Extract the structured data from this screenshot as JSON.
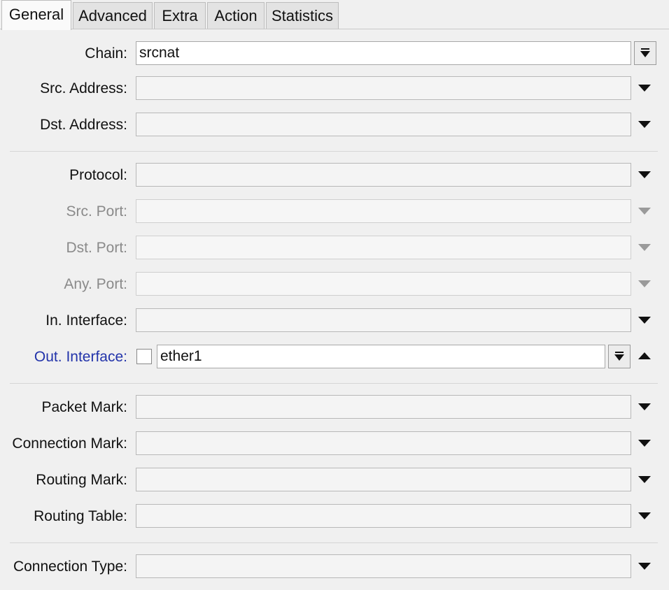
{
  "tabs": [
    {
      "label": "General",
      "active": true
    },
    {
      "label": "Advanced",
      "active": false
    },
    {
      "label": "Extra",
      "active": false
    },
    {
      "label": "Action",
      "active": false
    },
    {
      "label": "Statistics",
      "active": false
    }
  ],
  "fields": {
    "chain": {
      "label": "Chain:",
      "value": "srcnat"
    },
    "src_address": {
      "label": "Src. Address:",
      "value": ""
    },
    "dst_address": {
      "label": "Dst. Address:",
      "value": ""
    },
    "protocol": {
      "label": "Protocol:",
      "value": ""
    },
    "src_port": {
      "label": "Src. Port:",
      "value": "",
      "disabled": true
    },
    "dst_port": {
      "label": "Dst. Port:",
      "value": "",
      "disabled": true
    },
    "any_port": {
      "label": "Any. Port:",
      "value": "",
      "disabled": true
    },
    "in_interface": {
      "label": "In. Interface:",
      "value": ""
    },
    "out_interface": {
      "label": "Out. Interface:",
      "value": "ether1",
      "negate": false
    },
    "packet_mark": {
      "label": "Packet Mark:",
      "value": ""
    },
    "connection_mark": {
      "label": "Connection Mark:",
      "value": ""
    },
    "routing_mark": {
      "label": "Routing Mark:",
      "value": ""
    },
    "routing_table": {
      "label": "Routing Table:",
      "value": ""
    },
    "connection_type": {
      "label": "Connection Type:",
      "value": ""
    }
  },
  "colors": {
    "background": "#f0f0f0",
    "disabled_label": "#8a8a8a",
    "highlighted_label": "#2233aa"
  }
}
